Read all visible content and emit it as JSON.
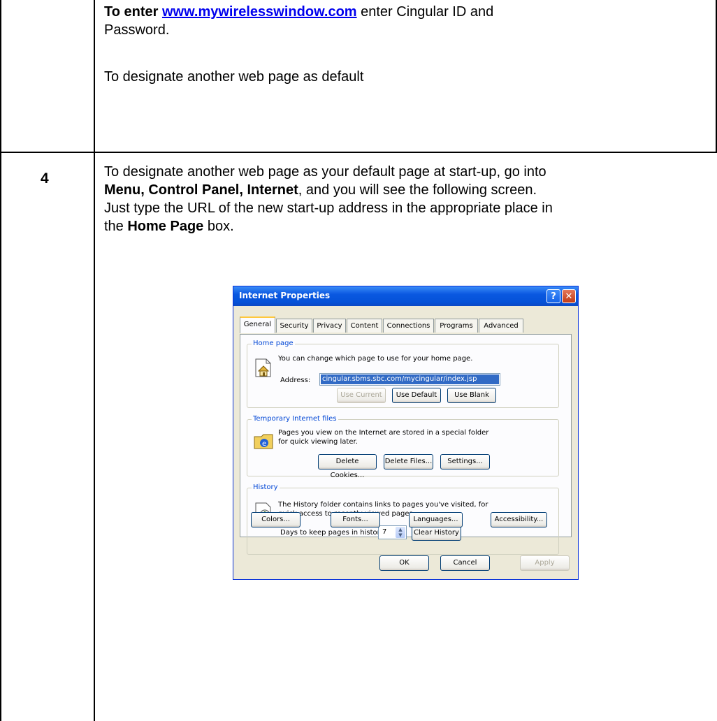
{
  "row1": {
    "line1_bold": "To enter ",
    "line1_link": "www.mywirelesswindow.com",
    "line1_rest": " enter Cingular ID and",
    "line2": "Password.",
    "line3": "To designate another web page as default"
  },
  "row2": {
    "number": "4",
    "t1": "To designate another web page as your default page at start-up, go into",
    "t2_bold": "Menu, Control Panel, Internet",
    "t2_rest": ", and you will see the following screen.",
    "t3": "Just type the URL of the new start-up address in the appropriate place in",
    "t4_pre": "the ",
    "t4_bold": "Home Page",
    "t4_rest": " box."
  },
  "dialog": {
    "title": "Internet Properties",
    "help_label": "?",
    "close_label": "✕",
    "tabs": [
      "General",
      "Security",
      "Privacy",
      "Content",
      "Connections",
      "Programs",
      "Advanced"
    ],
    "home_page": {
      "label": "Home page",
      "description": "You can change which page to use for your home page.",
      "address_label": "Address:",
      "address_value": "cingular.sbms.sbc.com/mycingular/index.jsp",
      "use_current": "Use Current",
      "use_default": "Use Default",
      "use_blank": "Use Blank"
    },
    "temp_files": {
      "label": "Temporary Internet files",
      "description_1": "Pages you view on the Internet are stored in a special folder",
      "description_2": "for quick viewing later.",
      "delete_cookies": "Delete Cookies...",
      "delete_files": "Delete Files...",
      "settings": "Settings..."
    },
    "history": {
      "label": "History",
      "description_1": "The History folder contains links to pages you've visited, for",
      "description_2": "quick access to recently viewed pages.",
      "days_label": "Days to keep pages in history:",
      "days_value": "7",
      "clear_history": "Clear History"
    },
    "bottom_buttons": {
      "colors": "Colors...",
      "fonts": "Fonts...",
      "languages": "Languages...",
      "accessibility": "Accessibility..."
    },
    "ok": "OK",
    "cancel": "Cancel",
    "apply": "Apply"
  }
}
